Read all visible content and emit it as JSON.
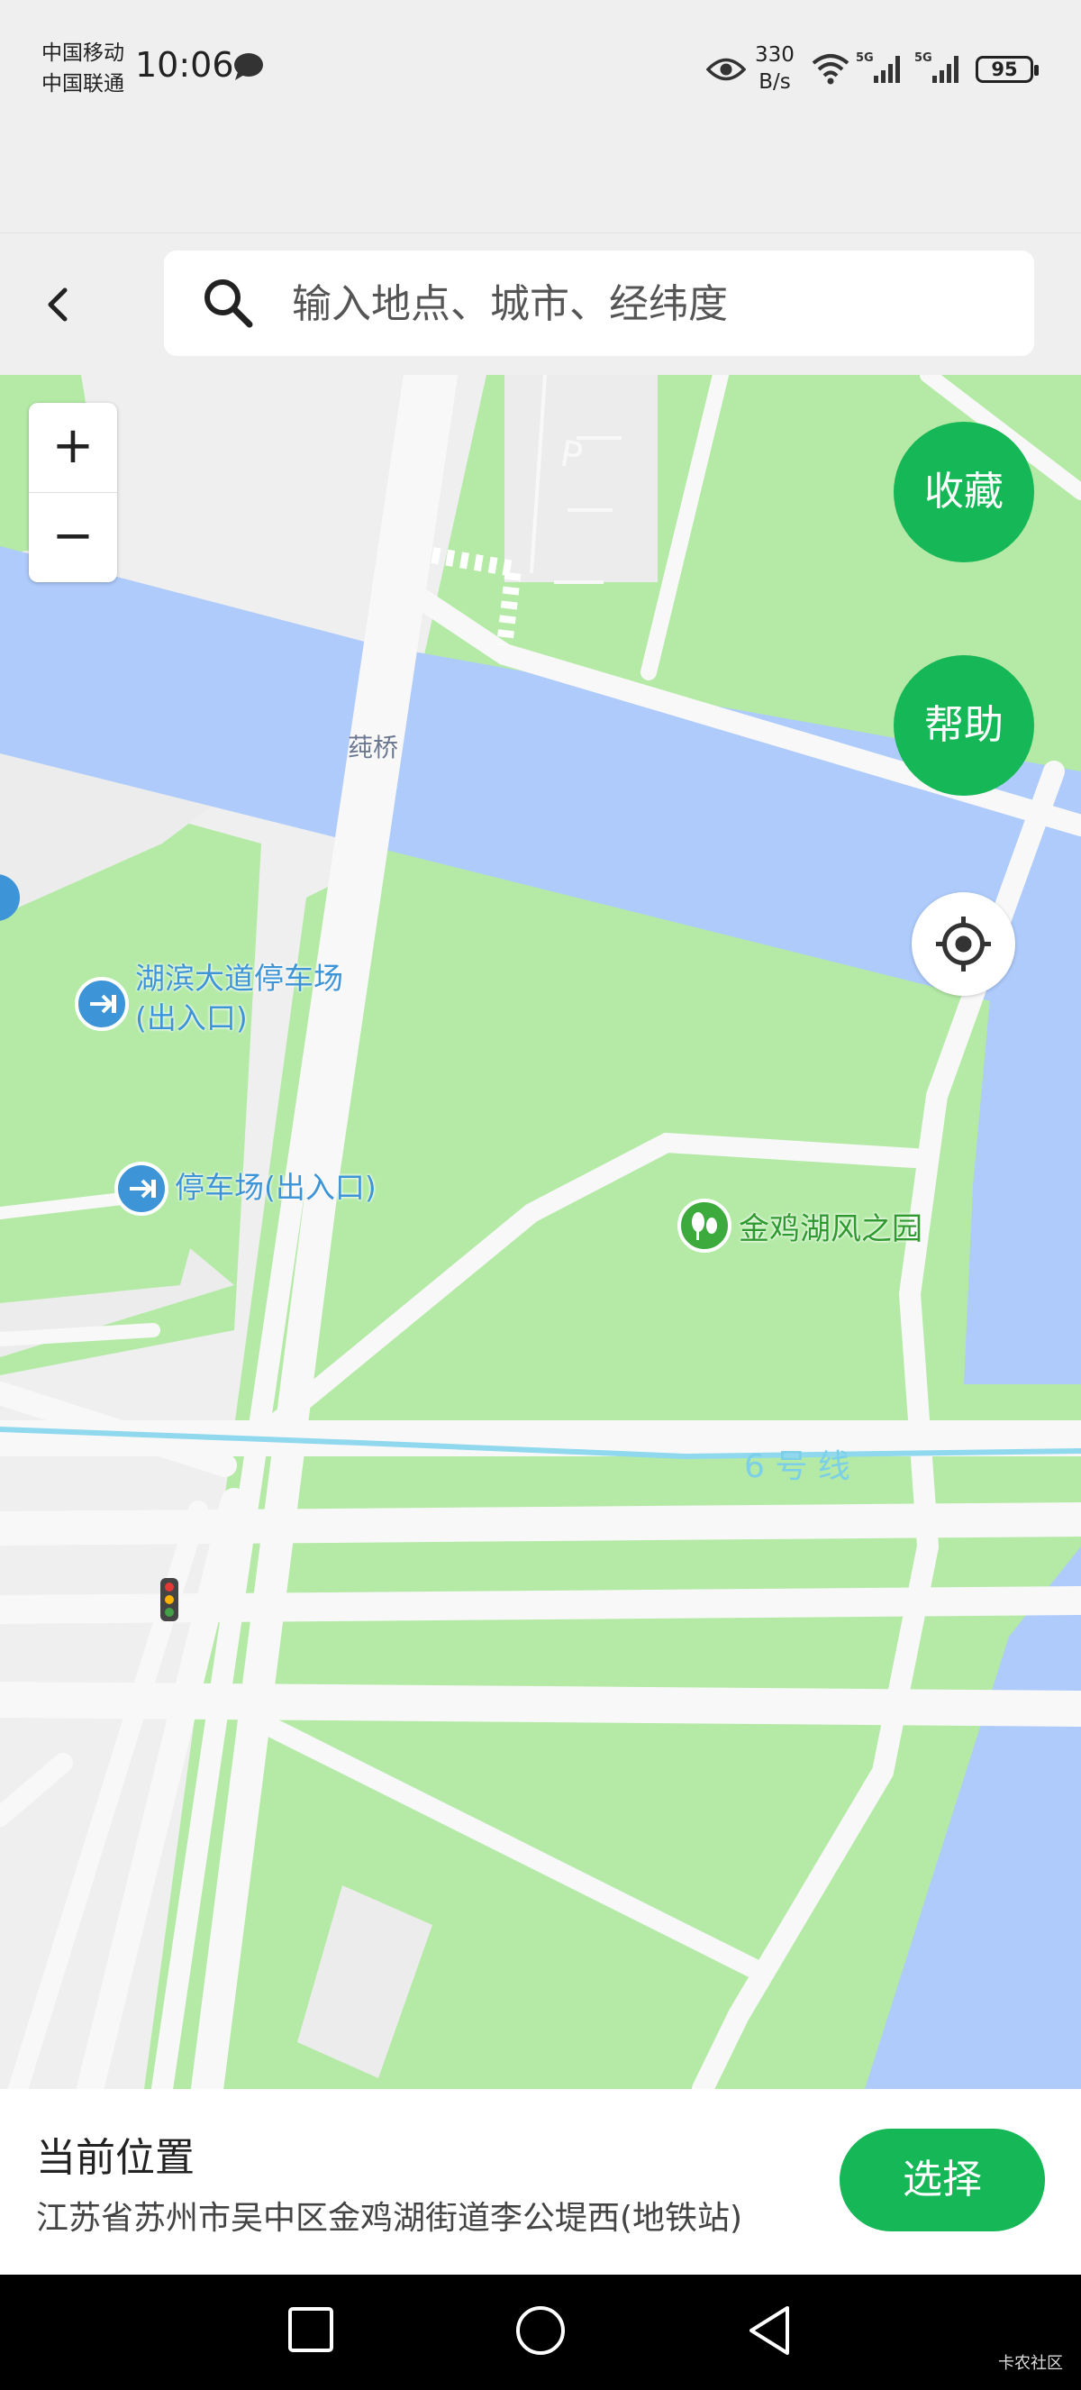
{
  "status_bar": {
    "carrier_1": "中国移动",
    "carrier_2": "中国联通",
    "time": "10:06",
    "net_speed_value": "330",
    "net_speed_unit": "B/s",
    "signal_1_label": "5G",
    "signal_2_label": "5G",
    "battery": "95"
  },
  "search": {
    "placeholder": "输入地点、城市、经纬度"
  },
  "map": {
    "zoom_in": "+",
    "zoom_out": "−",
    "favorite_label": "收藏",
    "help_label": "帮助",
    "bridge_label": "莼桥",
    "poi_parking_1_line1": "湖滨大道停车场",
    "poi_parking_1_line2": "(出入口)",
    "poi_parking_2": "停车场(出入口)",
    "poi_park": "金鸡湖风之园",
    "metro_line": "6 号 线",
    "colors": {
      "water": "#aecbfb",
      "green": "#b4eaa6",
      "road": "#f8f8f8",
      "metro": "#8fd8ee"
    }
  },
  "location_panel": {
    "title": "当前位置",
    "address": "江苏省苏州市吴中区金鸡湖街道李公堤西(地铁站)",
    "select_label": "选择"
  },
  "watermark": "卡农社区",
  "accent_color": "#16b757"
}
